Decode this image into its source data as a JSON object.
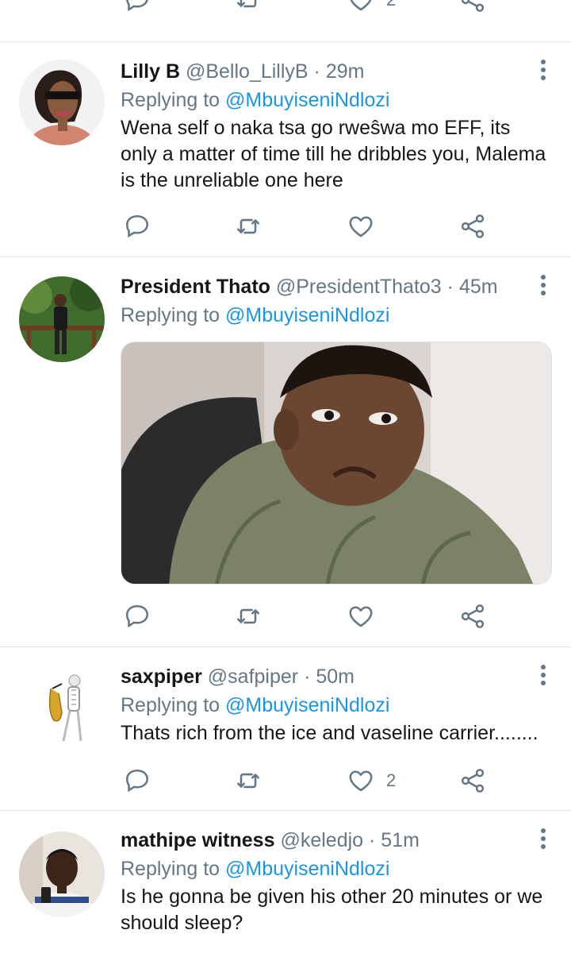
{
  "top_action_bar": {
    "like_count": "2"
  },
  "tweets": [
    {
      "name": "Lilly B",
      "handle": "@Bello_LillyB",
      "time": "29m",
      "replying_prefix": "Replying to",
      "replying_to": "@MbuyiseniNdlozi",
      "text": "Wena self o naka tsa go rweŝwa mo EFF, its only a matter of time till he dribbles you, Malema is the unreliable one here",
      "like_count": ""
    },
    {
      "name": "President Thato",
      "handle": "@PresidentThato3",
      "time": "45m",
      "replying_prefix": "Replying to",
      "replying_to": "@MbuyiseniNdlozi",
      "text": "",
      "like_count": ""
    },
    {
      "name": "saxpiper",
      "handle": "@safpiper",
      "time": "50m",
      "replying_prefix": "Replying to",
      "replying_to": "@MbuyiseniNdlozi",
      "text": "Thats rich from the ice and vaseline carrier........",
      "like_count": "2"
    },
    {
      "name": "mathipe witness",
      "handle": "@keledjo",
      "time": "51m",
      "replying_prefix": "Replying to",
      "replying_to": "@MbuyiseniNdlozi",
      "text": "Is he gonna be given his other 20 minutes or we should sleep?",
      "like_count": ""
    }
  ],
  "separator_dot": "·",
  "colors": {
    "accent": "#1b95e0",
    "secondary_text": "#657786",
    "divider": "#dfe3e6"
  }
}
